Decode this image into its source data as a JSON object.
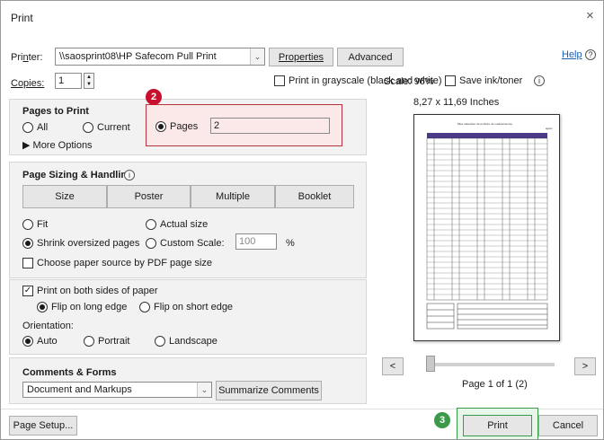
{
  "window": {
    "title": "Print",
    "close_glyph": "×"
  },
  "printer": {
    "label_pre": "Pri",
    "label_u": "n",
    "label_post": "ter:",
    "value": "\\\\saosprint08\\HP Safecom Pull Print",
    "properties_label": "Properties",
    "advanced_label": "Advanced",
    "help_label": "Help"
  },
  "copies": {
    "label": "Copies:",
    "value": "1"
  },
  "options": {
    "grayscale_label": "Print in grayscale (black and white)",
    "save_ink_label": "Save ink/toner"
  },
  "pages_to_print": {
    "title": "Pages to Print",
    "all_label": "All",
    "current_label": "Current",
    "pages_label": "Pages",
    "pages_value": "2",
    "more_options_label": "More Options",
    "marker": "2"
  },
  "page_sizing": {
    "title": "Page Sizing & Handling",
    "tabs": [
      "Size",
      "Poster",
      "Multiple",
      "Booklet"
    ],
    "fit_label": "Fit",
    "actual_size_label": "Actual size",
    "shrink_label": "Shrink oversized pages",
    "custom_scale_label": "Custom Scale:",
    "custom_scale_value": "100",
    "percent_label": "%",
    "paper_source_label": "Choose paper source by PDF page size"
  },
  "duplex": {
    "both_sides_label": "Print on both sides of paper",
    "long_edge_label": "Flip on long edge",
    "short_edge_label": "Flip on short edge"
  },
  "orientation": {
    "title": "Orientation:",
    "auto_label": "Auto",
    "portrait_label": "Portrait",
    "landscape_label": "Landscape"
  },
  "comments_forms": {
    "title": "Comments & Forms",
    "value": "Document and Markups",
    "summarize_label": "Summarize Comments"
  },
  "preview": {
    "scale_label": "Scale: 96%",
    "size_label": "8,27 x 11,69 Inches",
    "doc_title": "Mise calendrier de territoire de medicamentos",
    "doc_corner": "agosto",
    "page_label": "Page 1 of 1 (2)",
    "prev_glyph": "<",
    "next_glyph": ">"
  },
  "footer": {
    "page_setup_label": "Page Setup...",
    "print_label": "Print",
    "cancel_label": "Cancel",
    "marker": "3"
  },
  "colors": {
    "accent_red": "#c8102e",
    "accent_green": "#3a9a4a",
    "highlight_box": "#b8323a"
  }
}
